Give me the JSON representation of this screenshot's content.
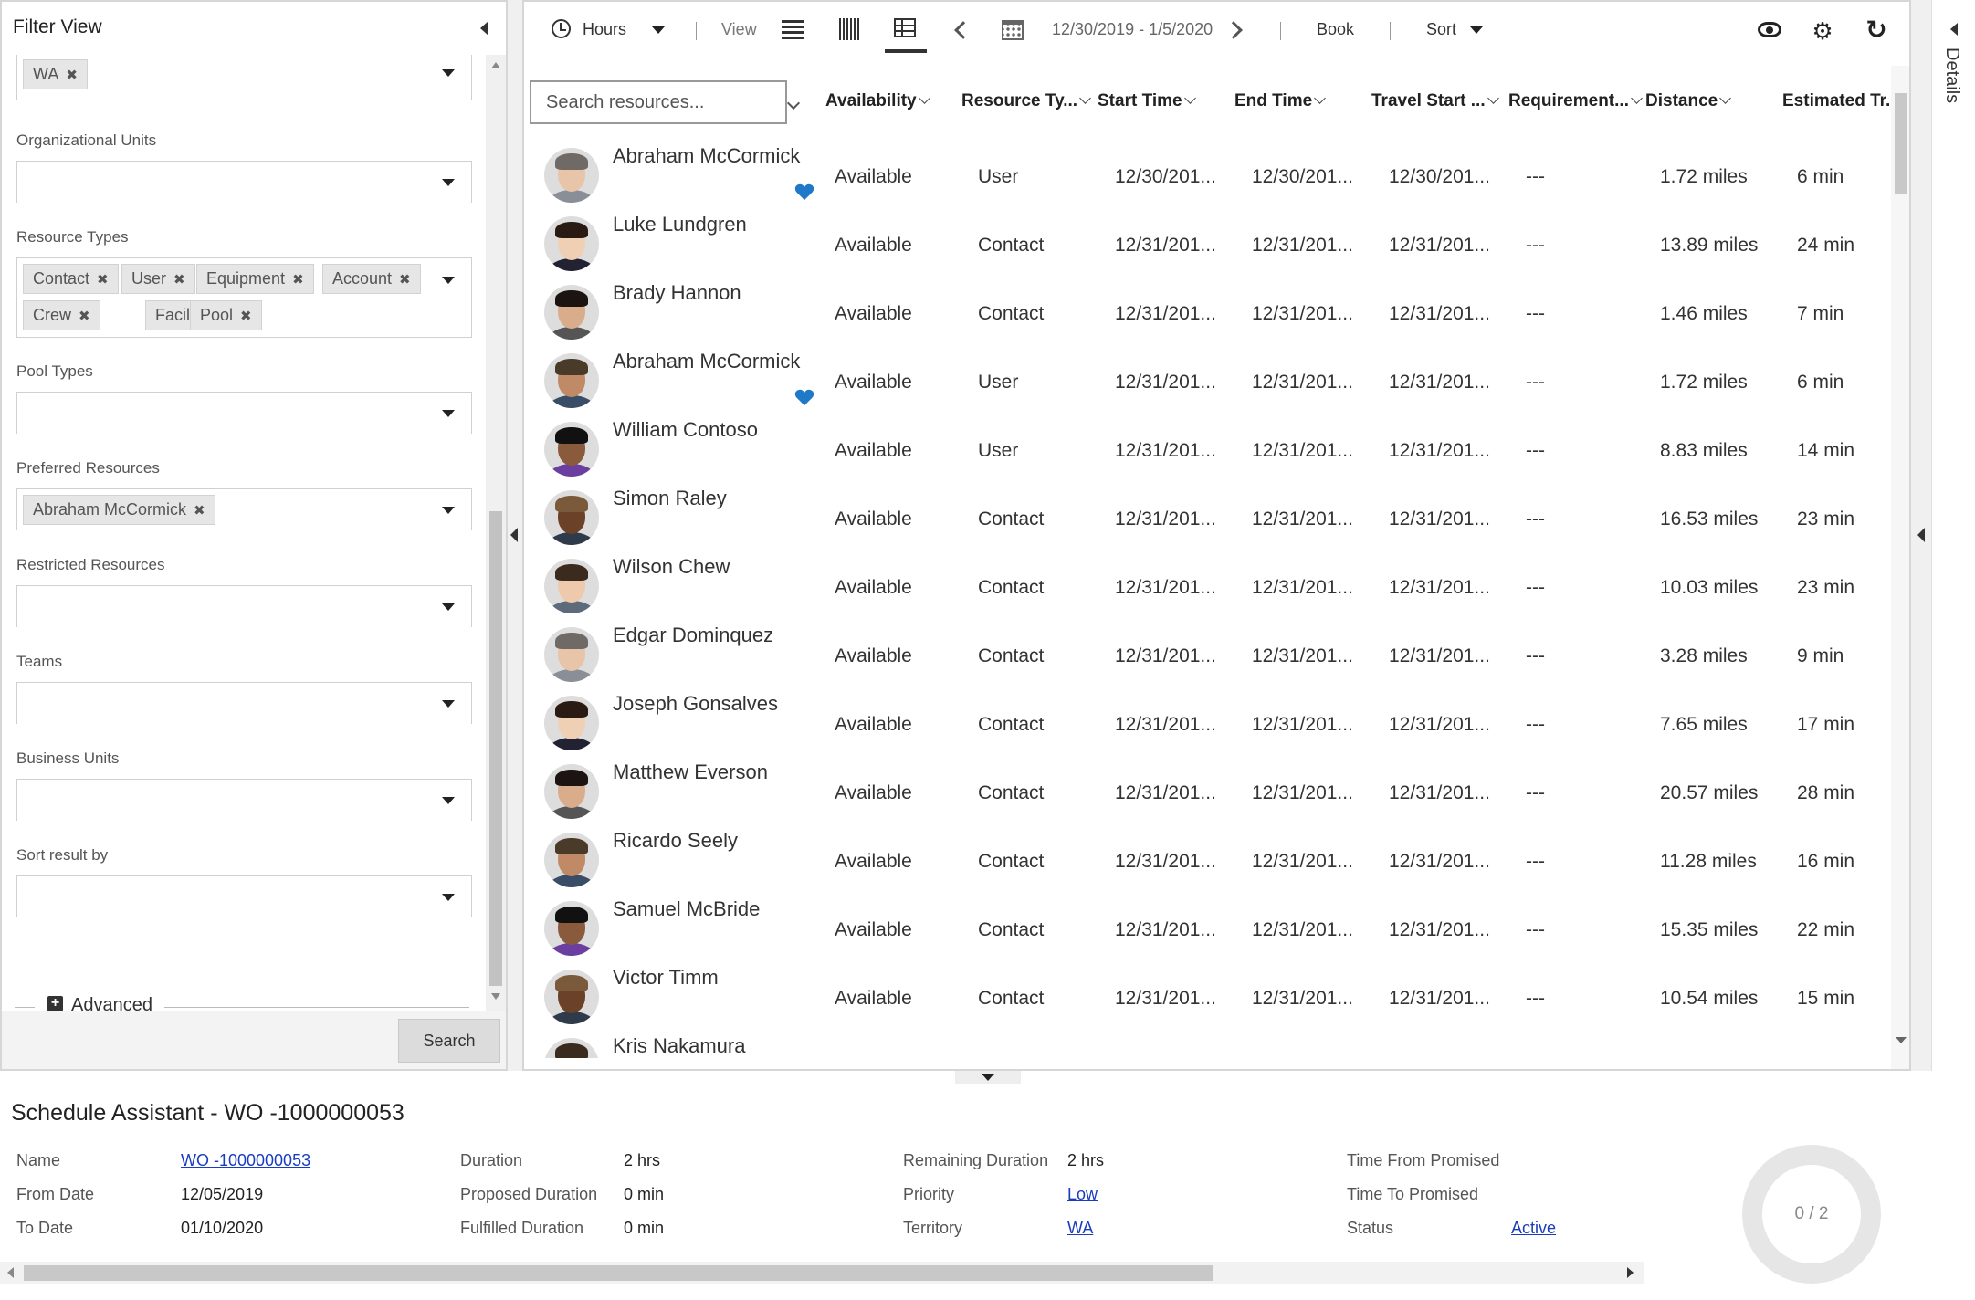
{
  "filter": {
    "title": "Filter View",
    "territory_chips": [
      "WA"
    ],
    "org_units_label": "Organizational Units",
    "resource_types_label": "Resource Types",
    "resource_type_chips": [
      "Contact",
      "User",
      "Equipment",
      "Account",
      "Crew",
      "Facility",
      "Pool"
    ],
    "pool_types_label": "Pool Types",
    "preferred_label": "Preferred Resources",
    "preferred_chips": [
      "Abraham McCormick"
    ],
    "restricted_label": "Restricted Resources",
    "teams_label": "Teams",
    "business_units_label": "Business Units",
    "sort_label": "Sort result by",
    "advanced_label": "Advanced",
    "search_button": "Search"
  },
  "toolbar": {
    "hours_label": "Hours",
    "view_label": "View",
    "date_range": "12/30/2019 - 1/5/2020",
    "book_label": "Book",
    "sort_label": "Sort"
  },
  "grid": {
    "search_placeholder": "Search resources...",
    "columns": [
      "Availability",
      "Resource Ty...",
      "Start Time",
      "End Time",
      "Travel Start ...",
      "Requirement...",
      "Distance",
      "Estimated Tr..."
    ],
    "rows": [
      {
        "name": "Abraham McCormick",
        "availability": "Available",
        "type": "User",
        "start": "12/30/201...",
        "end": "12/30/201...",
        "travel": "12/30/201...",
        "req": "---",
        "distance": "1.72 miles",
        "est": "6 min",
        "preferred": true
      },
      {
        "name": "Luke Lundgren",
        "availability": "Available",
        "type": "Contact",
        "start": "12/31/201...",
        "end": "12/31/201...",
        "travel": "12/31/201...",
        "req": "---",
        "distance": "13.89 miles",
        "est": "24 min",
        "preferred": false
      },
      {
        "name": "Brady Hannon",
        "availability": "Available",
        "type": "Contact",
        "start": "12/31/201...",
        "end": "12/31/201...",
        "travel": "12/31/201...",
        "req": "---",
        "distance": "1.46 miles",
        "est": "7 min",
        "preferred": false
      },
      {
        "name": "Abraham McCormick",
        "availability": "Available",
        "type": "User",
        "start": "12/31/201...",
        "end": "12/31/201...",
        "travel": "12/31/201...",
        "req": "---",
        "distance": "1.72 miles",
        "est": "6 min",
        "preferred": true
      },
      {
        "name": "William Contoso",
        "availability": "Available",
        "type": "User",
        "start": "12/31/201...",
        "end": "12/31/201...",
        "travel": "12/31/201...",
        "req": "---",
        "distance": "8.83 miles",
        "est": "14 min",
        "preferred": false
      },
      {
        "name": "Simon Raley",
        "availability": "Available",
        "type": "Contact",
        "start": "12/31/201...",
        "end": "12/31/201...",
        "travel": "12/31/201...",
        "req": "---",
        "distance": "16.53 miles",
        "est": "23 min",
        "preferred": false
      },
      {
        "name": "Wilson Chew",
        "availability": "Available",
        "type": "Contact",
        "start": "12/31/201...",
        "end": "12/31/201...",
        "travel": "12/31/201...",
        "req": "---",
        "distance": "10.03 miles",
        "est": "23 min",
        "preferred": false
      },
      {
        "name": "Edgar Dominquez",
        "availability": "Available",
        "type": "Contact",
        "start": "12/31/201...",
        "end": "12/31/201...",
        "travel": "12/31/201...",
        "req": "---",
        "distance": "3.28 miles",
        "est": "9 min",
        "preferred": false
      },
      {
        "name": "Joseph Gonsalves",
        "availability": "Available",
        "type": "Contact",
        "start": "12/31/201...",
        "end": "12/31/201...",
        "travel": "12/31/201...",
        "req": "---",
        "distance": "7.65 miles",
        "est": "17 min",
        "preferred": false
      },
      {
        "name": "Matthew Everson",
        "availability": "Available",
        "type": "Contact",
        "start": "12/31/201...",
        "end": "12/31/201...",
        "travel": "12/31/201...",
        "req": "---",
        "distance": "20.57 miles",
        "est": "28 min",
        "preferred": false
      },
      {
        "name": "Ricardo Seely",
        "availability": "Available",
        "type": "Contact",
        "start": "12/31/201...",
        "end": "12/31/201...",
        "travel": "12/31/201...",
        "req": "---",
        "distance": "11.28 miles",
        "est": "16 min",
        "preferred": false
      },
      {
        "name": "Samuel McBride",
        "availability": "Available",
        "type": "Contact",
        "start": "12/31/201...",
        "end": "12/31/201...",
        "travel": "12/31/201...",
        "req": "---",
        "distance": "15.35 miles",
        "est": "22 min",
        "preferred": false
      },
      {
        "name": "Victor Timm",
        "availability": "Available",
        "type": "Contact",
        "start": "12/31/201...",
        "end": "12/31/201...",
        "travel": "12/31/201...",
        "req": "---",
        "distance": "10.54 miles",
        "est": "15 min",
        "preferred": false
      },
      {
        "name": "Kris Nakamura",
        "availability": "",
        "type": "",
        "start": "",
        "end": "",
        "travel": "",
        "req": "",
        "distance": "",
        "est": "",
        "preferred": false
      }
    ]
  },
  "details_rail": {
    "label": "Details"
  },
  "schedule": {
    "title": "Schedule Assistant - WO -1000000053",
    "name_label": "Name",
    "name_value": "WO -1000000053",
    "from_label": "From Date",
    "from_value": "12/05/2019",
    "to_label": "To Date",
    "to_value": "01/10/2020",
    "duration_label": "Duration",
    "duration_value": "2 hrs",
    "proposed_label": "Proposed Duration",
    "proposed_value": "0 min",
    "fulfilled_label": "Fulfilled Duration",
    "fulfilled_value": "0 min",
    "remaining_label": "Remaining Duration",
    "remaining_value": "2 hrs",
    "priority_label": "Priority",
    "priority_value": "Low",
    "territory_label": "Territory",
    "territory_value": "WA",
    "tfp_label": "Time From Promised",
    "ttp_label": "Time To Promised",
    "status_label": "Status",
    "status_value": "Active",
    "progress_label": "0 / 2"
  },
  "colors": {
    "accent": "#1a6fc4",
    "link": "#1a3dbd",
    "heart": "#1f78c8"
  }
}
